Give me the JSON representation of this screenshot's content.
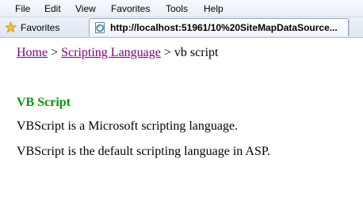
{
  "menu": {
    "items": [
      "File",
      "Edit",
      "View",
      "Favorites",
      "Tools",
      "Help"
    ]
  },
  "toolbar": {
    "favorites_label": "Favorites",
    "favorites_icon": "star-icon",
    "tab_icon": "ie-page-icon",
    "tab_title": "http://localhost:51961/10%20SiteMapDataSource..."
  },
  "breadcrumb": {
    "home": "Home",
    "separator_1": " > ",
    "scripting": "Scripting Language",
    "separator_2": " > ",
    "current": "vb script"
  },
  "content": {
    "heading": "VB Script",
    "paragraph_1": "VBScript is a Microsoft scripting language.",
    "paragraph_2": "VBScript is the default scripting language in ASP."
  },
  "colors": {
    "heading": "#009900",
    "visited_link": "#800080"
  }
}
